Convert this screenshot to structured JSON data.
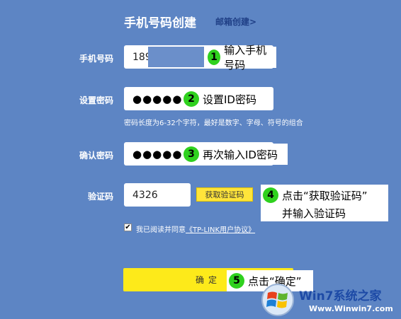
{
  "header": {
    "title": "手机号码创建",
    "email_link": "邮箱创建>"
  },
  "form": {
    "phone_label": "手机号码",
    "phone_value": "189",
    "pwd_label": "设置密码",
    "pwd_value": "●●●●●●",
    "pwd_hint": "密码长度为6-32个字符，最好是数字、字母、符号的组合",
    "confirm_label": "确认密码",
    "confirm_value": "●●●●●●",
    "captcha_label": "验证码",
    "captcha_value": "4326",
    "captcha_button": "获取验证码",
    "agree_text": "我已阅读并同意",
    "agree_link": "《TP-LINK用户协议》",
    "checkbox_mark": "✔",
    "submit_label": "确定"
  },
  "steps": [
    {
      "num": "1",
      "text": "输入手机号码"
    },
    {
      "num": "2",
      "text": "设置ID密码"
    },
    {
      "num": "3",
      "text": "再次输入ID密码"
    },
    {
      "num": "4",
      "text_line1": "点击“获取验证码”",
      "text_line2": "并输入验证码"
    },
    {
      "num": "5",
      "text": "点击“确定”"
    }
  ],
  "watermark": {
    "text": "Win7系统之家",
    "url": "Www.Winwin7.com"
  },
  "colors": {
    "background": "#5d85c4",
    "button_yellow": "#fdea1a",
    "step_green": "#2fd11e"
  }
}
